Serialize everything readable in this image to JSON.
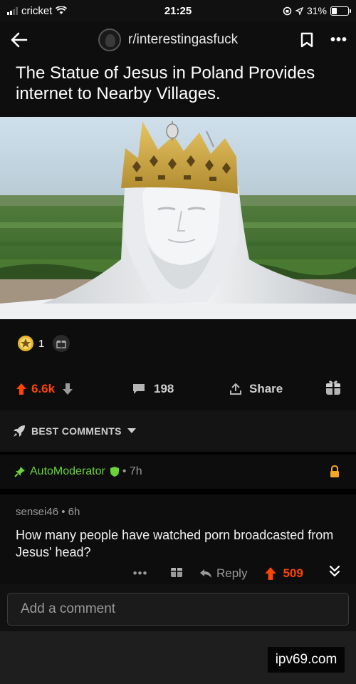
{
  "status": {
    "carrier": "cricket",
    "time": "21:25",
    "battery_percent_text": "31%",
    "battery_level": 0.31
  },
  "topbar": {
    "subreddit": "r/interestingasfuck"
  },
  "post": {
    "title": "The Statue of Jesus in Poland Provides internet to Nearby Villages.",
    "award_count": "1",
    "upvotes": "6.6k",
    "comments": "198",
    "share_label": "Share"
  },
  "sort": {
    "label": "BEST COMMENTS"
  },
  "sticky": {
    "author": "AutoModerator",
    "time": "7h"
  },
  "comment": {
    "author": "sensei46",
    "time": "6h",
    "body": "How many people have watched porn broadcasted from Jesus' head?",
    "reply_label": "Reply",
    "votes": "509"
  },
  "composer": {
    "placeholder": "Add a comment"
  },
  "watermark": "ipv69.com",
  "colors": {
    "upvote": "#ff4500",
    "moderator": "#6ad33a",
    "lock": "#f5a623"
  }
}
